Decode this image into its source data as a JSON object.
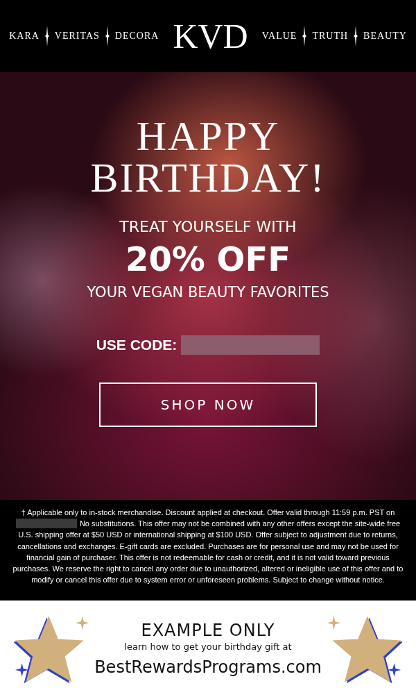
{
  "header": {
    "nav_left": [
      "KARA",
      "VERITAS",
      "DECORA"
    ],
    "logo": "KVD",
    "nav_right": [
      "VALUE",
      "TRUTH",
      "BEAUTY"
    ]
  },
  "hero": {
    "title_lines": [
      "HAPPY",
      "BIRTHDAY!"
    ],
    "subtitle": "TREAT YOURSELF WITH",
    "offer": "20% OFF",
    "tagline": "YOUR VEGAN BEAUTY FAVORITES",
    "code_label": "USE CODE:",
    "button": "SHOP NOW"
  },
  "disclaimer": {
    "before": "† Applicable only to in-stock merchandise. Discount applied at checkout. Offer valid through 11:59 p.m. PST on",
    "after_first_line": "No substitutions. This offer may not be combined with any other offers except the site-wide free",
    "after": "U.S. shipping offer at $50 USD or international shipping at $100 USD. Offer subject to adjustment due to returns, cancellations and exchanges. E-gift cards are excluded. Purchases are for personal use and may not be used for financial gain of purchaser. This offer is not redeemable for cash or credit, and it is not valid toward previous purchases. We reserve the right to cancel any order due to unauthorized, altered or ineligible use of this offer and to modify or cancel this offer due to system error or unforeseen problems. Subject to change without notice."
  },
  "banner": {
    "title": "EXAMPLE ONLY",
    "subtitle": "learn how to get your birthday gift at",
    "site": "BestRewardsPrograms.com"
  }
}
